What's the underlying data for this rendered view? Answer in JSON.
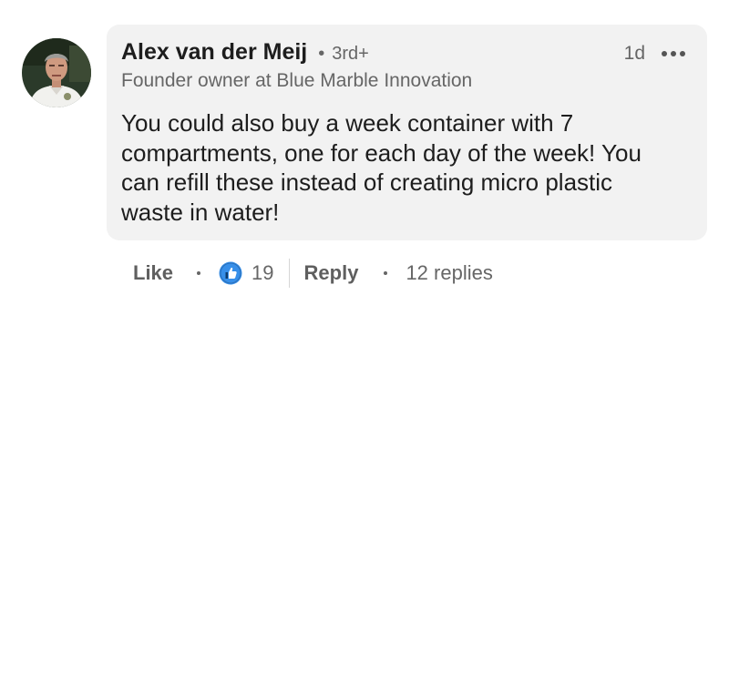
{
  "comment": {
    "author": {
      "name": "Alex van der Meij",
      "degree": "3rd+",
      "headline": "Founder owner at Blue Marble Innovation"
    },
    "timestamp": "1d",
    "separator": "•",
    "text": "You could also buy a week container with 7 compartments, one for each day of the week! You can refill these instead of creating micro plastic waste in water!",
    "actions": {
      "like_label": "Like",
      "reaction_count": "19",
      "reply_label": "Reply",
      "replies_label": "12 replies"
    },
    "icons": {
      "avatar": "profile-photo",
      "more": "more-options-icon",
      "reaction": "thumbs-up-icon"
    },
    "colors": {
      "bubble": "#f2f2f2",
      "like_reaction": "#378fe9",
      "text": "#1d1d1d",
      "secondary_text": "#666666"
    }
  }
}
